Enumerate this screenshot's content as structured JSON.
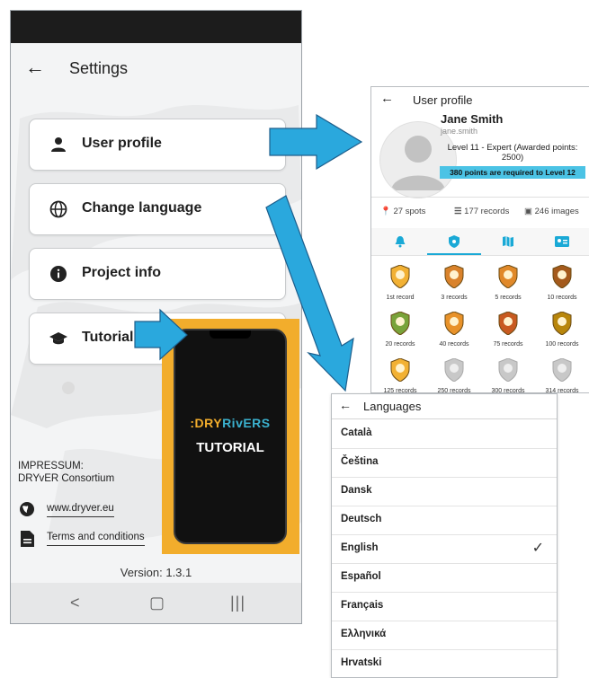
{
  "settings": {
    "title": "Settings",
    "back_icon": "arrow-left-icon",
    "menu": [
      {
        "label": "User profile",
        "icon": "person-icon"
      },
      {
        "label": "Change language",
        "icon": "globe-icon"
      },
      {
        "label": "Project info",
        "icon": "info-icon"
      },
      {
        "label": "Tutorial",
        "icon": "graduation-cap-icon"
      }
    ],
    "impressum_line1": "IMPRESSUM:",
    "impressum_line2": "DRYvER Consortium",
    "website": "www.dryver.eu",
    "terms": "Terms and conditions",
    "version": "Version: 1.3.1"
  },
  "tutorial": {
    "brand_prefix": ":DRY",
    "brand_suffix": "RivERS",
    "label": "TUTORIAL"
  },
  "profile": {
    "title": "User profile",
    "name": "Jane Smith",
    "username": "jane.smith",
    "level": "Level 11 - Expert (Awarded points: 2500)",
    "points_needed": "380 points are required to Level 12",
    "stats": {
      "spots": "27 spots",
      "records": "177 records",
      "images": "246 images"
    },
    "badges": [
      {
        "label": "1st record",
        "color": "#f2b134"
      },
      {
        "label": "3 records",
        "color": "#d9822b"
      },
      {
        "label": "5 records",
        "color": "#e0892a"
      },
      {
        "label": "10 records",
        "color": "#a45a1c"
      },
      {
        "label": "20 records",
        "color": "#79a33a"
      },
      {
        "label": "40 records",
        "color": "#e8922a"
      },
      {
        "label": "75 records",
        "color": "#c85a20"
      },
      {
        "label": "100 records",
        "color": "#b8860b"
      },
      {
        "label": "125 records",
        "color": "#f2b134"
      },
      {
        "label": "250 records",
        "color": "#c8c8c8"
      },
      {
        "label": "300 records",
        "color": "#c8c8c8"
      },
      {
        "label": "314 records",
        "color": "#c8c8c8"
      }
    ]
  },
  "languages": {
    "title": "Languages",
    "items": [
      "Català",
      "Čeština",
      "Dansk",
      "Deutsch",
      "English",
      "Español",
      "Français",
      "Ελληνικά",
      "Hrvatski"
    ],
    "selected": "English",
    "check": "✓"
  }
}
